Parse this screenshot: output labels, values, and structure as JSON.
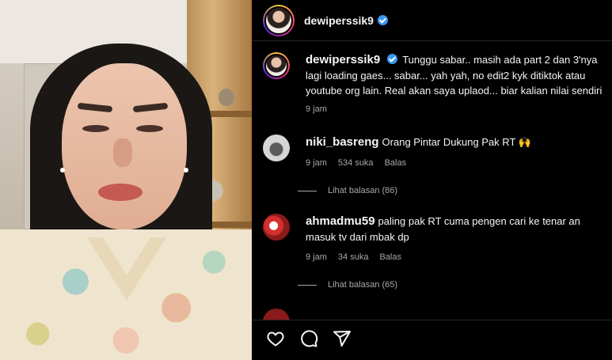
{
  "post": {
    "username": "dewiperssik9"
  },
  "caption": {
    "username": "dewiperssik9",
    "line1": "Tunggu sabar.. masih ada part 2 dan 3'nya",
    "line2": "lagi loading gaes... sabar... yah yah, no edit2 kyk ditiktok atau",
    "line3": "youtube org lain. Real akan saya uplaod... biar kalian nilai sendiri",
    "time": "9 jam"
  },
  "comments": [
    {
      "username": "niki_basreng",
      "text": "Orang Pintar Dukung Pak RT 🙌",
      "time": "9 jam",
      "likes": "534 suka",
      "reply_label": "Balas",
      "view_replies": "Lihat balasan (86)"
    },
    {
      "username": "ahmadmu59",
      "text_line1": "paling pak RT cuma pengen cari ke tenar an",
      "text_line2": "masuk tv dari mbak dp",
      "time": "9 jam",
      "likes": "34 suka",
      "reply_label": "Balas",
      "view_replies": "Lihat balasan (65)"
    }
  ],
  "actions": {
    "like_icon": "heart-icon",
    "comment_icon": "comment-icon",
    "share_icon": "share-icon"
  },
  "colors": {
    "verified": "#3897f0",
    "background": "#000000",
    "secondary_text": "#a8a8a8"
  }
}
